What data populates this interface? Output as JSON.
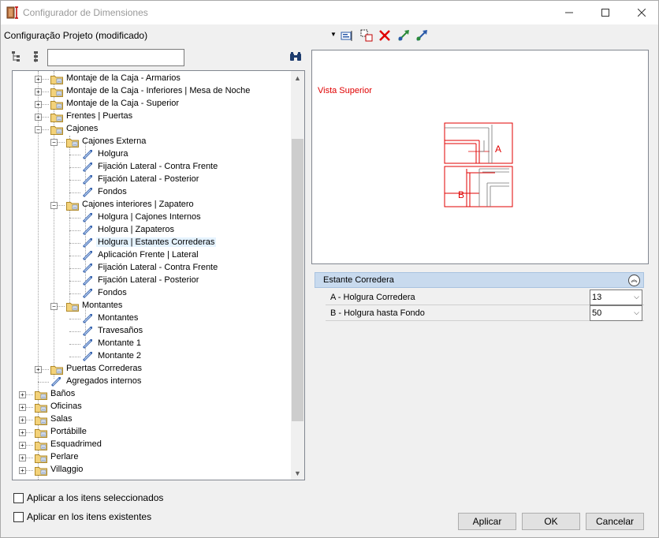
{
  "window": {
    "title": "Configurador de Dimensiones",
    "controls": {
      "minimize": "—",
      "maximize": "☐",
      "close": "✕"
    }
  },
  "project": {
    "label": "Configuração Projeto (modificado)"
  },
  "search": {
    "value": ""
  },
  "tree": [
    {
      "label": "Montaje de la Caja - Armarios",
      "level": 2,
      "kind": "folder",
      "expander": "+"
    },
    {
      "label": "Montaje de la Caja - Inferiores | Mesa de Noche",
      "level": 2,
      "kind": "folder",
      "expander": "+"
    },
    {
      "label": "Montaje de la Caja - Superior",
      "level": 2,
      "kind": "folder",
      "expander": "+"
    },
    {
      "label": "Frentes | Puertas",
      "level": 2,
      "kind": "folder",
      "expander": "+"
    },
    {
      "label": "Cajones",
      "level": 2,
      "kind": "folder",
      "expander": "-"
    },
    {
      "label": "Cajones Externa",
      "level": 3,
      "kind": "folder",
      "expander": "-"
    },
    {
      "label": "Holgura",
      "level": 4,
      "kind": "leaf"
    },
    {
      "label": "Fijación Lateral - Contra Frente",
      "level": 4,
      "kind": "leaf"
    },
    {
      "label": "Fijación Lateral - Posterior",
      "level": 4,
      "kind": "leaf"
    },
    {
      "label": "Fondos",
      "level": 4,
      "kind": "leaf"
    },
    {
      "label": "Cajones interiores | Zapatero",
      "level": 3,
      "kind": "folder",
      "expander": "-"
    },
    {
      "label": "Holgura | Cajones Internos",
      "level": 4,
      "kind": "leaf"
    },
    {
      "label": "Holgura | Zapateros",
      "level": 4,
      "kind": "leaf"
    },
    {
      "label": "Holgura | Estantes Correderas",
      "level": 4,
      "kind": "leaf",
      "selected": true
    },
    {
      "label": "Aplicación Frente | Lateral",
      "level": 4,
      "kind": "leaf"
    },
    {
      "label": "Fijación Lateral - Contra Frente",
      "level": 4,
      "kind": "leaf"
    },
    {
      "label": "Fijación Lateral - Posterior",
      "level": 4,
      "kind": "leaf"
    },
    {
      "label": "Fondos",
      "level": 4,
      "kind": "leaf"
    },
    {
      "label": "Montantes",
      "level": 3,
      "kind": "folder",
      "expander": "-"
    },
    {
      "label": "Montantes",
      "level": 4,
      "kind": "leaf"
    },
    {
      "label": "Travesaños",
      "level": 4,
      "kind": "leaf"
    },
    {
      "label": "Montante 1",
      "level": 4,
      "kind": "leaf"
    },
    {
      "label": "Montante 2",
      "level": 4,
      "kind": "leaf"
    },
    {
      "label": "Puertas Correderas",
      "level": 2,
      "kind": "folder",
      "expander": "+"
    },
    {
      "label": "Agregados internos",
      "level": 2,
      "kind": "leaf"
    },
    {
      "label": "Baños",
      "level": 1,
      "kind": "folder",
      "expander": "+"
    },
    {
      "label": "Oficinas",
      "level": 1,
      "kind": "folder",
      "expander": "+"
    },
    {
      "label": "Salas",
      "level": 1,
      "kind": "folder",
      "expander": "+"
    },
    {
      "label": "Portábille",
      "level": 1,
      "kind": "folder",
      "expander": "+"
    },
    {
      "label": "Esquadrimed",
      "level": 1,
      "kind": "folder",
      "expander": "+"
    },
    {
      "label": "Perlare",
      "level": 1,
      "kind": "folder",
      "expander": "+"
    },
    {
      "label": "Villaggio",
      "level": 1,
      "kind": "folder",
      "expander": "+"
    },
    {
      "label": "",
      "level": 1,
      "kind": "folder",
      "expander": "+"
    }
  ],
  "preview": {
    "view_label": "Vista Superior",
    "marker_a": "A",
    "marker_b": "B",
    "line_color": "#e00000"
  },
  "properties": {
    "group_title": "Estante Corredera",
    "rows": [
      {
        "name": "A - Holgura Corredera",
        "value": "13"
      },
      {
        "name": "B - Holgura hasta Fondo",
        "value": "50"
      }
    ]
  },
  "options": {
    "apply_selected": "Aplicar a los itens seleccionados",
    "apply_existing": "Aplicar en los itens existentes"
  },
  "buttons": {
    "apply": "Aplicar",
    "ok": "OK",
    "cancel": "Cancelar"
  },
  "colors": {
    "accent_header": "#c8daee",
    "selection": "#e5f3ff"
  }
}
